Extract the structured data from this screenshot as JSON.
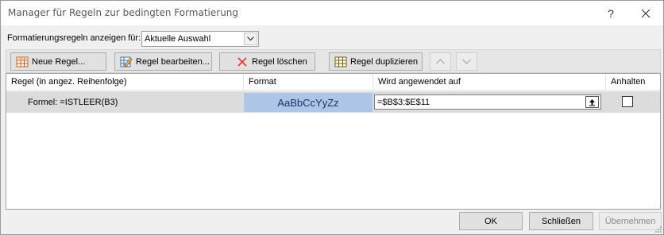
{
  "window": {
    "title": "Manager für Regeln zur bedingten Formatierung",
    "help_label": "?"
  },
  "show_rules": {
    "label": "Formatierungsregeln anzeigen für:",
    "selected": "Aktuelle Auswahl"
  },
  "toolbar": {
    "new_rule": "Neue Regel...",
    "edit_rule": "Regel bearbeiten...",
    "delete_rule": "Regel löschen",
    "duplicate_rule": "Regel duplizieren"
  },
  "columns": {
    "rule": "Regel (in angez. Reihenfolge)",
    "format": "Format",
    "applies_to": "Wird angewendet auf",
    "stop": "Anhalten"
  },
  "rules": [
    {
      "rule": "Formel: =ISTLEER(B3)",
      "format_preview": "AaBbCcYyZz",
      "applies_to": "=$B$3:$E$11",
      "stop_if_true": false
    }
  ],
  "footer": {
    "ok": "OK",
    "close": "Schließen",
    "apply": "Übernehmen"
  },
  "colors": {
    "format_preview_bg": "#adc5e7",
    "selected_row_bg": "#dcdcdc"
  }
}
